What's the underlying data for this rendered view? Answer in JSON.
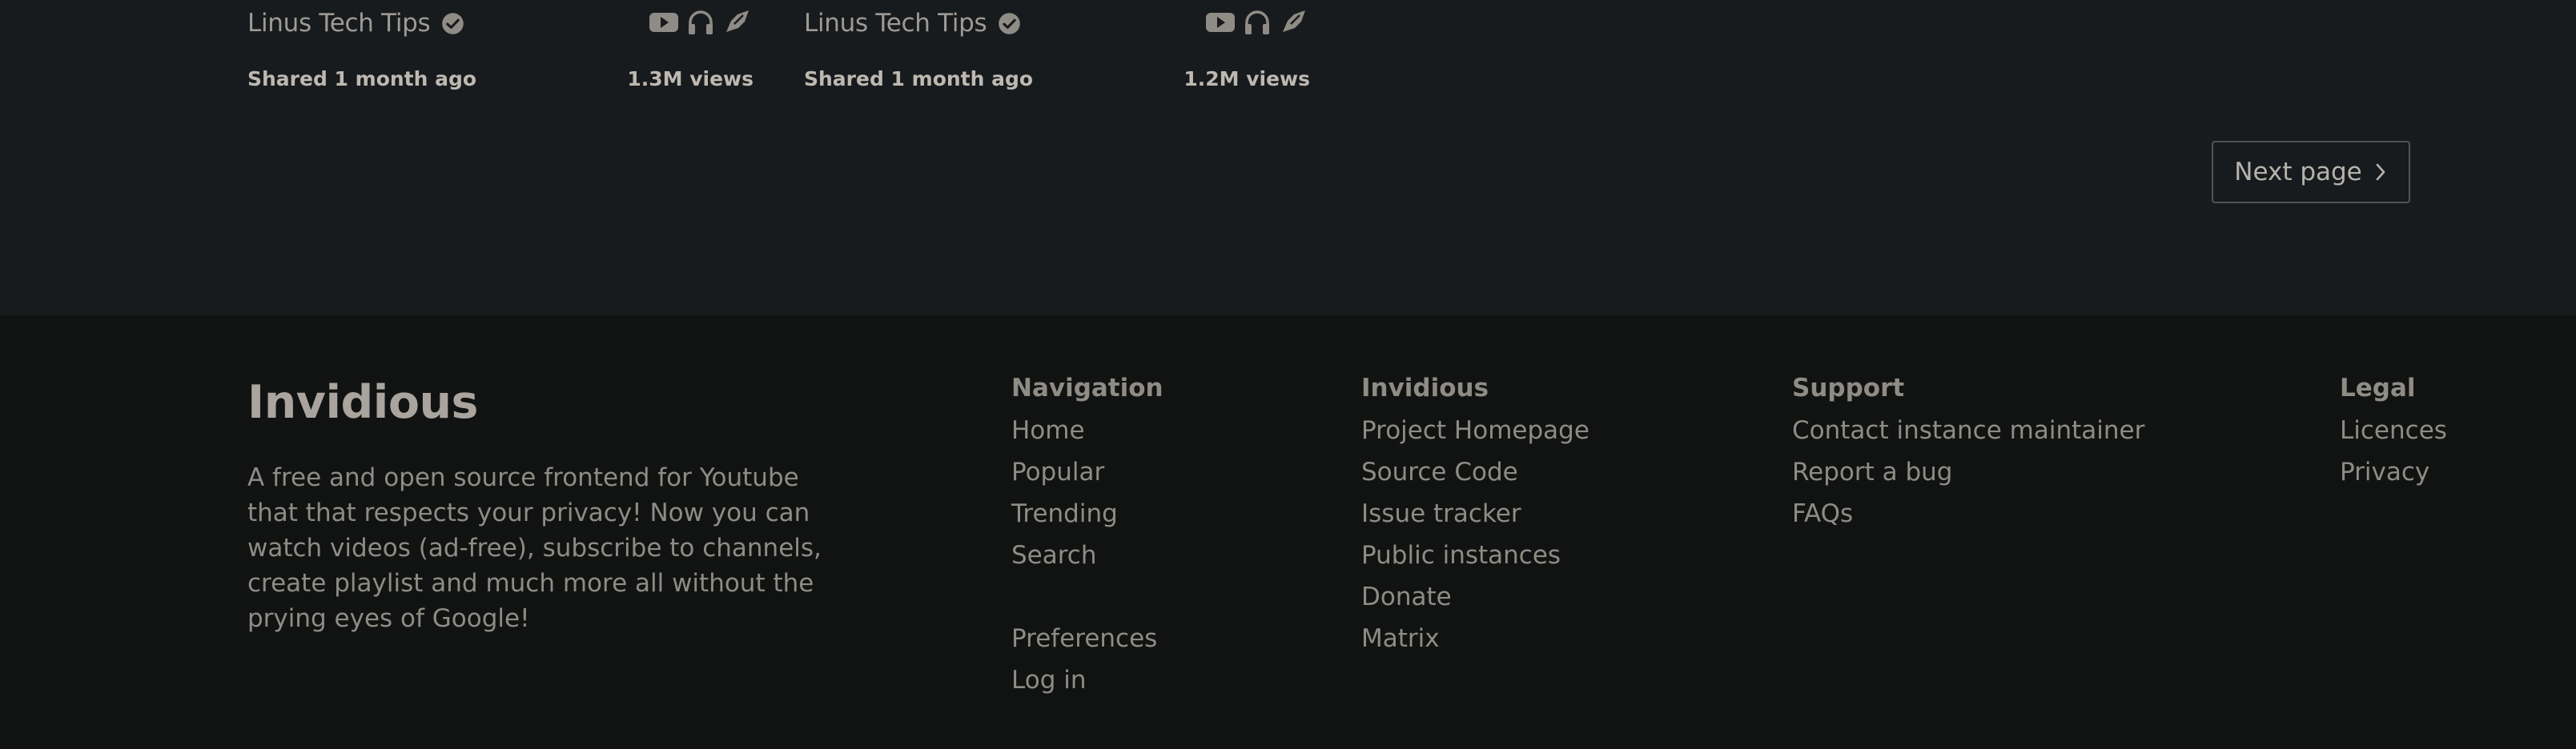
{
  "video_cards": [
    {
      "channel": "Linus Tech Tips",
      "shared": "Shared 1 month ago",
      "views": "1.3M views",
      "icons": [
        "youtube-icon",
        "headphones-icon",
        "share-icon"
      ]
    },
    {
      "channel": "Linus Tech Tips",
      "shared": "Shared 1 month ago",
      "views": "1.2M views",
      "icons": [
        "youtube-icon",
        "headphones-icon",
        "share-icon"
      ]
    }
  ],
  "pagination": {
    "next_label": "Next page"
  },
  "footer": {
    "brand": "Invidious",
    "description": "A free and open source frontend for Youtube that that respects your privacy! Now you can watch videos (ad-free), subscribe to channels, create playlist and much more all without the prying eyes of Google!",
    "columns": {
      "navigation": {
        "title": "Navigation",
        "items": [
          "Home",
          "Popular",
          "Trending",
          "Search",
          "Preferences",
          "Log in"
        ]
      },
      "invidious": {
        "title": "Invidious",
        "items": [
          "Project Homepage",
          "Source Code",
          "Issue tracker",
          "Public instances",
          "Donate",
          "Matrix"
        ]
      },
      "support": {
        "title": "Support",
        "items": [
          "Contact instance maintainer",
          "Report a bug",
          "FAQs"
        ]
      },
      "legal": {
        "title": "Legal",
        "items": [
          "Licences",
          "Privacy"
        ]
      }
    }
  },
  "colors": {
    "page_bg": "#181b1d",
    "footer_bg": "#111312",
    "text": "#8f8b85"
  }
}
